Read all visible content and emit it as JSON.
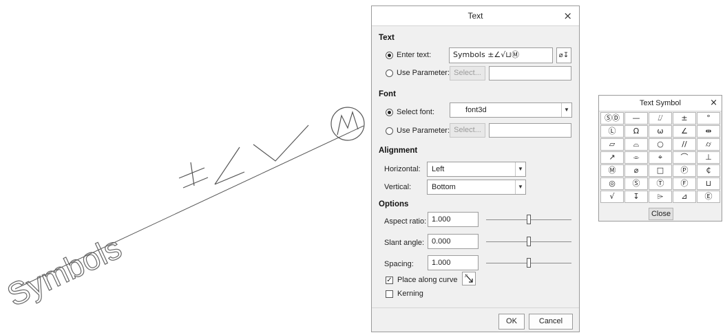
{
  "canvas": {
    "text_word": "Symbols",
    "annotation_symbols": "±∠√Ⓜ"
  },
  "text_dialog": {
    "title": "Text",
    "close_glyph": "×",
    "sections": {
      "text": "Text",
      "font": "Font",
      "alignment": "Alignment",
      "options": "Options"
    },
    "text": {
      "enter_text_label": "Enter text:",
      "enter_text_selected": true,
      "enter_text_value": "Symbols ±∠√⊔Ⓜ",
      "symbol_button_glyph": "⌀↧",
      "use_parameter_label": "Use Parameter:",
      "use_parameter_selected": false,
      "select_button": "Select...",
      "parameter_value": ""
    },
    "font": {
      "select_font_label": "Select font:",
      "select_font_selected": true,
      "font_value": "font3d",
      "use_parameter_label": "Use Parameter:",
      "use_parameter_selected": false,
      "select_button": "Select...",
      "parameter_value": ""
    },
    "alignment": {
      "horizontal_label": "Horizontal:",
      "horizontal_value": "Left",
      "vertical_label": "Vertical:",
      "vertical_value": "Bottom"
    },
    "options": {
      "aspect_ratio_label": "Aspect ratio:",
      "aspect_ratio_value": "1.000",
      "slant_angle_label": "Slant angle:",
      "slant_angle_value": "0.000",
      "spacing_label": "Spacing:",
      "spacing_value": "1.000",
      "slider_level": 0.5,
      "place_along_curve_label": "Place along curve",
      "place_along_curve_checked": true,
      "kerning_label": "Kerning",
      "kerning_checked": false
    },
    "ok_button": "OK",
    "cancel_button": "Cancel"
  },
  "symbol_palette": {
    "title": "Text Symbol",
    "close_glyph": "×",
    "symbols": [
      "ⓈⒹ",
      "—",
      "⌰",
      "±",
      "°",
      "Ⓛ",
      "Ω",
      "ω",
      "∠",
      "⇹",
      "▱",
      "⌓",
      "○",
      "//",
      "⌭",
      "↗",
      "⌯",
      "⌖",
      "⌒",
      "⊥",
      "Ⓜ",
      "⌀",
      "□",
      "Ⓟ",
      "₵",
      "◎",
      "Ⓢ",
      "Ⓣ",
      "Ⓕ",
      "⊔",
      "√",
      "↧",
      "⌲",
      "⊿",
      "Ⓔ"
    ],
    "close_button": "Close"
  }
}
